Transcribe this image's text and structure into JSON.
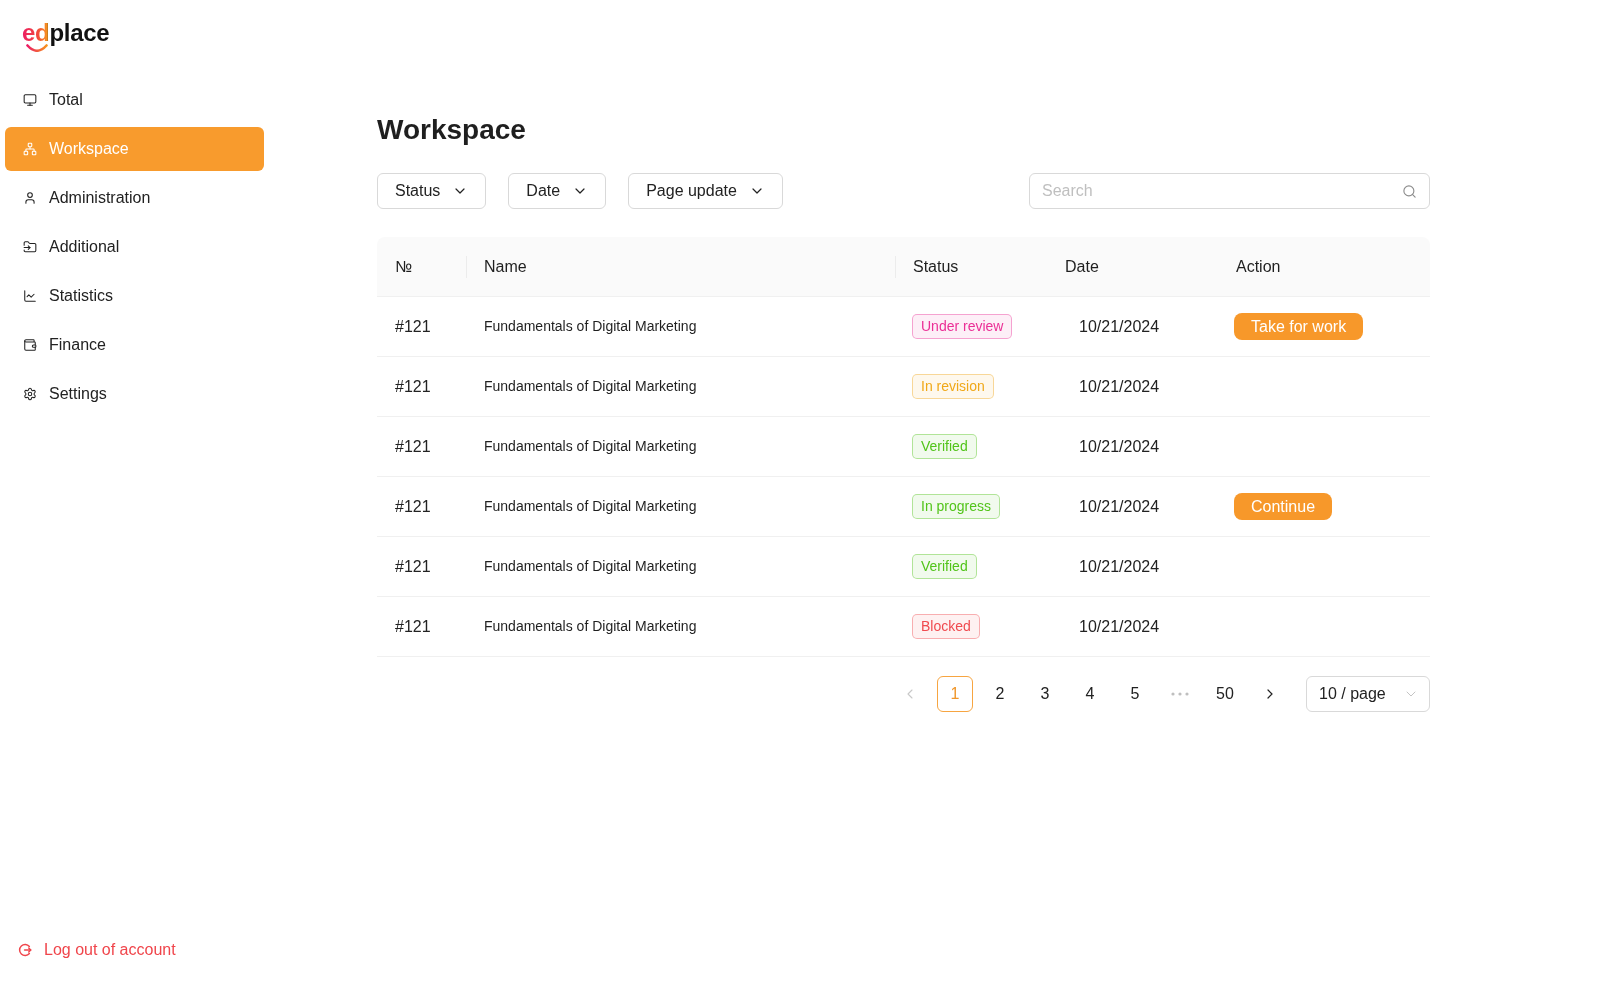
{
  "logo": {
    "text": "edplace"
  },
  "sidebar": {
    "items": [
      {
        "label": "Total",
        "selected": false
      },
      {
        "label": "Workspace",
        "selected": true
      },
      {
        "label": "Administration",
        "selected": false
      },
      {
        "label": "Additional",
        "selected": false
      },
      {
        "label": "Statistics",
        "selected": false
      },
      {
        "label": "Finance",
        "selected": false
      },
      {
        "label": "Settings",
        "selected": false
      }
    ],
    "logout": "Log out of account"
  },
  "page": {
    "title": "Workspace"
  },
  "filters": [
    {
      "label": "Status"
    },
    {
      "label": "Date"
    },
    {
      "label": "Page update"
    }
  ],
  "search": {
    "placeholder": "Search"
  },
  "table": {
    "columns": [
      "№",
      "Name",
      "Status",
      "Date",
      "Action"
    ],
    "rows": [
      {
        "number": "#121",
        "name": "Fundamentals of Digital Marketing",
        "status": {
          "label": "Under review",
          "color": "#eb2f96"
        },
        "date": "10/21/2024",
        "action": "Take for work"
      },
      {
        "number": "#121",
        "name": "Fundamentals of Digital Marketing",
        "status": {
          "label": "In revision",
          "color": "#f0a818"
        },
        "date": "10/21/2024"
      },
      {
        "number": "#121",
        "name": "Fundamentals of Digital Marketing",
        "status": {
          "label": "Verified",
          "color": "#52c41a"
        },
        "date": "10/21/2024"
      },
      {
        "number": "#121",
        "name": "Fundamentals of Digital Marketing",
        "status": {
          "label": "In progress",
          "color": "#52c41a"
        },
        "date": "10/21/2024",
        "action": "Continue"
      },
      {
        "number": "#121",
        "name": "Fundamentals of Digital Marketing",
        "status": {
          "label": "Verified",
          "color": "#52c41a"
        },
        "date": "10/21/2024"
      },
      {
        "number": "#121",
        "name": "Fundamentals of Digital Marketing",
        "status": {
          "label": "Blocked",
          "color": "#f04a4f"
        },
        "date": "10/21/2024"
      }
    ]
  },
  "pagination": {
    "prev": {
      "disabled": true
    },
    "pages": [
      {
        "kind": "page",
        "label": "1",
        "selected": true
      },
      {
        "kind": "page",
        "label": "2",
        "selected": false
      },
      {
        "kind": "page",
        "label": "3",
        "selected": false
      },
      {
        "kind": "page",
        "label": "4",
        "selected": false
      },
      {
        "kind": "page",
        "label": "5",
        "selected": false
      },
      {
        "kind": "ellipsis"
      },
      {
        "kind": "page",
        "label": "50",
        "selected": false
      }
    ],
    "next": {
      "disabled": false
    },
    "page_size": "10 / page"
  }
}
